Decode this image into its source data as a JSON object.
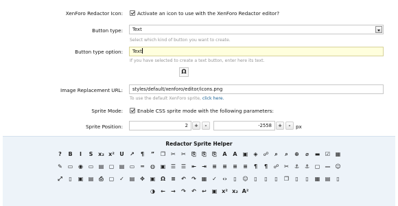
{
  "form": {
    "redactor_icon": {
      "label": "XenForo Redactor Icon:",
      "checkbox_label": "Activate an icon to use with the XenForo Redactor editor?",
      "checked": true
    },
    "button_type": {
      "label": "Button type:",
      "selected": "Text",
      "hint": "Select which kind of button you want to create."
    },
    "button_type_option": {
      "label": "Button type option:",
      "value": "Text",
      "hint": "If you have selected to create a text button, enter here its text.",
      "omega_button": "Ω"
    },
    "image_url": {
      "label": "Image Replacement URL:",
      "value": "styles/default/xenforo/editor/icons.png",
      "hint": "To use the default XenForo sprite,",
      "hint_link": "click here."
    },
    "sprite_mode": {
      "label": "Sprite Mode:",
      "checkbox_label": "Enable CSS sprite mode with the following parameters:",
      "checked": true
    },
    "sprite_position": {
      "label": "Sprite Position:",
      "x": "2",
      "y": "-2558",
      "plus": "+",
      "minus": "-",
      "unit": "px"
    }
  },
  "helper": {
    "title": "Redactor Sprite Helper",
    "rows": [
      [
        "help",
        "bold",
        "italic",
        "strikethrough",
        "subscript",
        "superscript",
        "underline",
        "show-blocks",
        "paragraph",
        "quote",
        "copy",
        "cut",
        "cut-alt",
        "paste",
        "paste-text",
        "paste-word",
        "text-color",
        "background-color",
        "image",
        "flash",
        "link",
        "find",
        "find-replace",
        "zoom",
        "remove-format",
        "block",
        "checkbox",
        "table"
      ],
      [
        "format-painter",
        "form-button",
        "radio",
        "text-field",
        "textarea",
        "hidden-field",
        "list-box",
        "div",
        "page-break",
        "globe",
        "image-edit",
        "ordered-list",
        "unordered-list",
        "outdent",
        "indent",
        "align-left",
        "align-center",
        "align-right",
        "align-justify",
        "ltr",
        "rtl",
        "link-edit",
        "unlink",
        "anchor",
        "anchor-remove",
        "iframe",
        "horizontal-rule",
        "smiley"
      ],
      [
        "maximize",
        "new-page",
        "save",
        "template",
        "print",
        "preview",
        "spellcheck",
        "templates",
        "drag",
        "select-all",
        "special-char",
        "source",
        "undo",
        "redo",
        "table-insert",
        "spellcheck-alt",
        "code",
        "document",
        "smiley-alt",
        "page",
        "page-add",
        "page-delete",
        "page-copy",
        "page-edit",
        "page-zoom",
        "grid",
        "page-list",
        "page-alt"
      ],
      [
        "pie-chart",
        "back",
        "forward",
        "redo-alt",
        "undo-alt",
        "reply",
        "gallery",
        "superscript-alt",
        "subscript-alt",
        "font-size"
      ]
    ]
  }
}
